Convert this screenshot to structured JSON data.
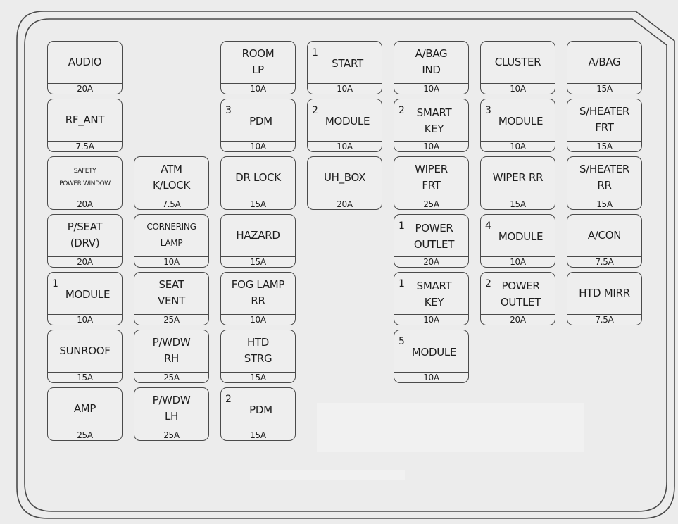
{
  "diagram": {
    "title": "",
    "frame_color": "#4a4a4a",
    "background_color": "#ececec",
    "fuses": [
      {
        "id": "r1c1",
        "row": 1,
        "col": 1,
        "label": "AUDIO",
        "index": "",
        "rating": "20A"
      },
      {
        "id": "r1c3",
        "row": 1,
        "col": 3,
        "label": "ROOM\nLP",
        "index": "",
        "rating": "10A"
      },
      {
        "id": "r1c4",
        "row": 1,
        "col": 4,
        "label": "START",
        "index": "1",
        "rating": "10A"
      },
      {
        "id": "r1c5",
        "row": 1,
        "col": 5,
        "label": "A/BAG\nIND",
        "index": "",
        "rating": "10A"
      },
      {
        "id": "r1c6",
        "row": 1,
        "col": 6,
        "label": "CLUSTER",
        "index": "",
        "rating": "10A"
      },
      {
        "id": "r1c7",
        "row": 1,
        "col": 7,
        "label": "A/BAG",
        "index": "",
        "rating": "15A"
      },
      {
        "id": "r2c1",
        "row": 2,
        "col": 1,
        "label": "RF_ANT",
        "index": "",
        "rating": "7.5A"
      },
      {
        "id": "r2c3",
        "row": 2,
        "col": 3,
        "label": "PDM",
        "index": "3",
        "rating": "10A"
      },
      {
        "id": "r2c4",
        "row": 2,
        "col": 4,
        "label": "MODULE",
        "index": "2",
        "rating": "10A"
      },
      {
        "id": "r2c5",
        "row": 2,
        "col": 5,
        "label": "SMART\nKEY",
        "index": "2",
        "rating": "10A"
      },
      {
        "id": "r2c6",
        "row": 2,
        "col": 6,
        "label": "MODULE",
        "index": "3",
        "rating": "10A"
      },
      {
        "id": "r2c7",
        "row": 2,
        "col": 7,
        "label": "S/HEATER\nFRT",
        "index": "",
        "rating": "15A"
      },
      {
        "id": "r3c1",
        "row": 3,
        "col": 1,
        "label": "SAFETY\nPOWER WINDOW",
        "index": "",
        "rating": "20A",
        "size": "small"
      },
      {
        "id": "r3c2",
        "row": 3,
        "col": 2,
        "label": "ATM\nK/LOCK",
        "index": "",
        "rating": "7.5A"
      },
      {
        "id": "r3c3",
        "row": 3,
        "col": 3,
        "label": "DR LOCK",
        "index": "",
        "rating": "15A"
      },
      {
        "id": "r3c4",
        "row": 3,
        "col": 4,
        "label": "UH_BOX",
        "index": "",
        "rating": "20A"
      },
      {
        "id": "r3c5",
        "row": 3,
        "col": 5,
        "label": "WIPER\nFRT",
        "index": "",
        "rating": "25A"
      },
      {
        "id": "r3c6",
        "row": 3,
        "col": 6,
        "label": "WIPER RR",
        "index": "",
        "rating": "15A"
      },
      {
        "id": "r3c7",
        "row": 3,
        "col": 7,
        "label": "S/HEATER\nRR",
        "index": "",
        "rating": "15A"
      },
      {
        "id": "r4c1",
        "row": 4,
        "col": 1,
        "label": "P/SEAT\n(DRV)",
        "index": "",
        "rating": "20A"
      },
      {
        "id": "r4c2",
        "row": 4,
        "col": 2,
        "label": "CORNERING\nLAMP",
        "index": "",
        "rating": "10A",
        "size": "medium"
      },
      {
        "id": "r4c3",
        "row": 4,
        "col": 3,
        "label": "HAZARD",
        "index": "",
        "rating": "15A"
      },
      {
        "id": "r4c5",
        "row": 4,
        "col": 5,
        "label": "POWER\nOUTLET",
        "index": "1",
        "rating": "20A"
      },
      {
        "id": "r4c6",
        "row": 4,
        "col": 6,
        "label": "MODULE",
        "index": "4",
        "rating": "10A"
      },
      {
        "id": "r4c7",
        "row": 4,
        "col": 7,
        "label": "A/CON",
        "index": "",
        "rating": "7.5A"
      },
      {
        "id": "r5c1",
        "row": 5,
        "col": 1,
        "label": "MODULE",
        "index": "1",
        "rating": "10A"
      },
      {
        "id": "r5c2",
        "row": 5,
        "col": 2,
        "label": "SEAT\nVENT",
        "index": "",
        "rating": "25A"
      },
      {
        "id": "r5c3",
        "row": 5,
        "col": 3,
        "label": "FOG LAMP\nRR",
        "index": "",
        "rating": "10A"
      },
      {
        "id": "r5c5",
        "row": 5,
        "col": 5,
        "label": "SMART\nKEY",
        "index": "1",
        "rating": "10A"
      },
      {
        "id": "r5c6",
        "row": 5,
        "col": 6,
        "label": "POWER\nOUTLET",
        "index": "2",
        "rating": "20A"
      },
      {
        "id": "r5c7",
        "row": 5,
        "col": 7,
        "label": "HTD MIRR",
        "index": "",
        "rating": "7.5A"
      },
      {
        "id": "r6c1",
        "row": 6,
        "col": 1,
        "label": "SUNROOF",
        "index": "",
        "rating": "15A"
      },
      {
        "id": "r6c2",
        "row": 6,
        "col": 2,
        "label": "P/WDW\nRH",
        "index": "",
        "rating": "25A"
      },
      {
        "id": "r6c3",
        "row": 6,
        "col": 3,
        "label": "HTD\nSTRG",
        "index": "",
        "rating": "15A"
      },
      {
        "id": "r6c5",
        "row": 6,
        "col": 5,
        "label": "MODULE",
        "index": "5",
        "rating": "10A"
      },
      {
        "id": "r7c1",
        "row": 7,
        "col": 1,
        "label": "AMP",
        "index": "",
        "rating": "25A"
      },
      {
        "id": "r7c2",
        "row": 7,
        "col": 2,
        "label": "P/WDW\nLH",
        "index": "",
        "rating": "25A"
      },
      {
        "id": "r7c3",
        "row": 7,
        "col": 3,
        "label": "PDM",
        "index": "2",
        "rating": "15A"
      }
    ]
  }
}
